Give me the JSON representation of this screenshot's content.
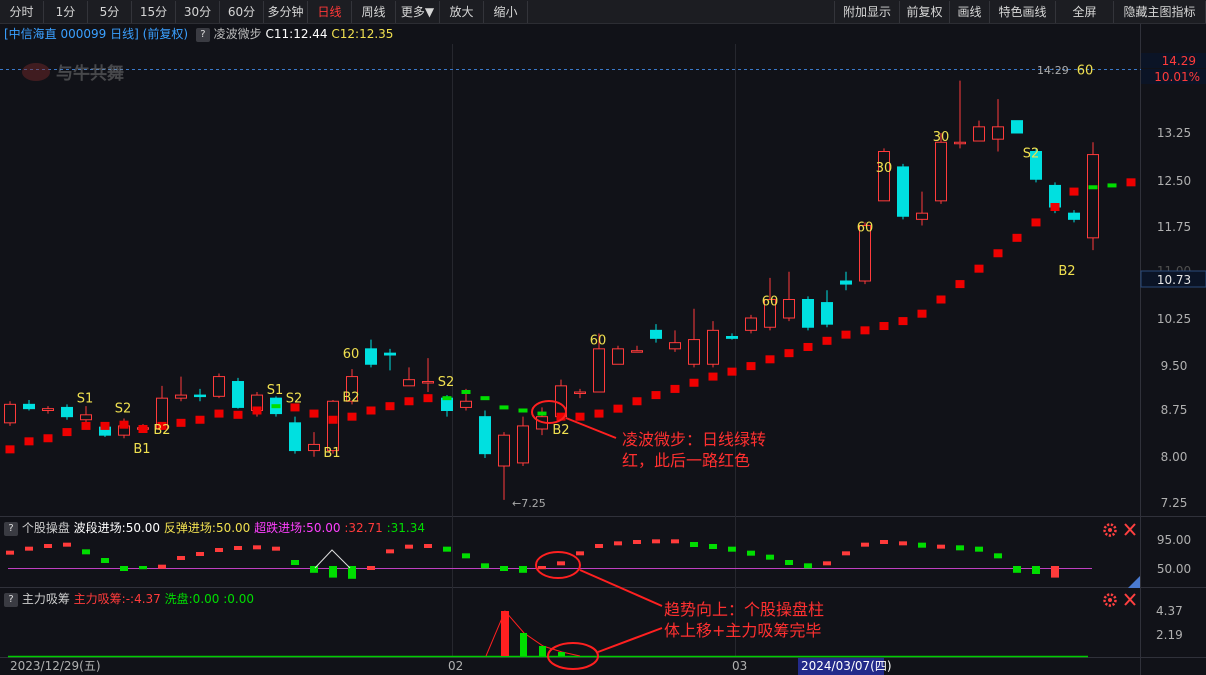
{
  "toolbar": {
    "left": [
      "分时",
      "1分",
      "5分",
      "15分",
      "30分",
      "60分",
      "多分钟",
      "日线",
      "周线",
      "更多▼",
      "放大",
      "缩小"
    ],
    "active": "日线",
    "right": [
      "附加显示",
      "前复权",
      "画线",
      "特色画线",
      "全屏",
      "隐藏主图指标"
    ]
  },
  "main_info": {
    "stock": "[中信海直 000099 日线]",
    "adjust": "(前复权)",
    "q": "?",
    "indicator": "凌波微步",
    "c1": "C11:12.44",
    "c2": "C12:12.35"
  },
  "watermark": "与牛共舞",
  "price_axis": {
    "ticks": [
      "13.25",
      "12.50",
      "11.75",
      "10.25",
      "9.50",
      "8.75",
      "8.00",
      "7.25"
    ],
    "top_price": "14.29",
    "top_pct": "10.01%",
    "cur_price": "10.73",
    "high_label": "14:29",
    "low_label": "7.25",
    "hidden_tick": "11.00"
  },
  "signals": [
    {
      "t": "S1",
      "c": 85,
      "p": 8.88
    },
    {
      "t": "S2",
      "c": 123,
      "p": 8.72
    },
    {
      "t": "B1",
      "c": 142,
      "p": 8.06
    },
    {
      "t": "B2",
      "c": 162,
      "p": 8.37
    },
    {
      "t": "S1",
      "c": 275,
      "p": 9.02
    },
    {
      "t": "S2",
      "c": 294,
      "p": 8.88
    },
    {
      "t": "B1",
      "c": 332,
      "p": 8.0
    },
    {
      "t": "60",
      "c": 351,
      "p": 9.6
    },
    {
      "t": "B2",
      "c": 351,
      "p": 8.9
    },
    {
      "t": "S2",
      "c": 446,
      "p": 9.15
    },
    {
      "t": "B2",
      "c": 561,
      "p": 8.37
    },
    {
      "t": "60",
      "c": 598,
      "p": 9.82
    },
    {
      "t": "60",
      "c": 770,
      "p": 10.45
    },
    {
      "t": "60",
      "c": 865,
      "p": 11.65
    },
    {
      "t": "30",
      "c": 884,
      "p": 12.62
    },
    {
      "t": "30",
      "c": 941,
      "p": 13.12
    },
    {
      "t": "S2",
      "c": 1031,
      "p": 12.85
    },
    {
      "t": "B2",
      "c": 1067,
      "p": 10.95
    },
    {
      "t": "60",
      "c": 1085,
      "p": 14.2
    }
  ],
  "annotation1": {
    "line1": "凌波微步：日线绿转",
    "line2": "红，此后一路红色"
  },
  "annotation2": {
    "line1": "趋势向上：个股操盘柱",
    "line2": "体上移+主力吸筹完毕"
  },
  "panel2": {
    "q": "?",
    "name": "个股操盘",
    "v1": "波段进场:50.00",
    "v2": "反弹进场:50.00",
    "v3": "超跌进场:50.00",
    "v4": ":32.71",
    "v5": ":31.34",
    "ticks": [
      "95.00",
      "50.00"
    ]
  },
  "panel3": {
    "q": "?",
    "name": "主力吸筹",
    "v1": "主力吸筹:-",
    "v1b": ":4.37",
    "v2": "洗盘:0.00",
    "v3": ":0.00",
    "ticks": [
      "4.37",
      "2.19"
    ]
  },
  "date_axis": {
    "d1": "2023/12/29(五)",
    "d2": "02",
    "d3": "03",
    "d4": "2024/03/07(四)"
  },
  "colors": {
    "up": "#ff3b3b",
    "down": "#00e0e0",
    "ma_red": "#ee0000",
    "ma_green": "#00dd00",
    "signal": "#f0e050",
    "annot": "#ff3030"
  },
  "candles": [
    [
      8.55,
      8.85,
      8.9,
      8.5
    ],
    [
      8.85,
      8.78,
      8.92,
      8.75
    ],
    [
      8.75,
      8.78,
      8.82,
      8.7
    ],
    [
      8.8,
      8.65,
      8.85,
      8.6
    ],
    [
      8.6,
      8.68,
      8.82,
      8.5
    ],
    [
      8.48,
      8.35,
      8.55,
      8.32
    ],
    [
      8.35,
      8.5,
      8.62,
      8.3
    ],
    [
      8.45,
      8.47,
      8.53,
      8.42
    ],
    [
      8.45,
      8.95,
      9.15,
      8.45
    ],
    [
      8.95,
      9.0,
      9.3,
      8.9
    ],
    [
      9.0,
      8.98,
      9.1,
      8.9
    ],
    [
      8.98,
      9.3,
      9.35,
      8.95
    ],
    [
      9.22,
      8.8,
      9.28,
      8.78
    ],
    [
      8.75,
      9.0,
      9.05,
      8.65
    ],
    [
      8.95,
      8.7,
      8.98,
      8.65
    ],
    [
      8.55,
      8.1,
      8.65,
      8.05
    ],
    [
      8.1,
      8.2,
      8.4,
      8.0
    ],
    [
      8.1,
      8.9,
      8.92,
      8.05
    ],
    [
      8.9,
      9.3,
      9.42,
      8.85
    ],
    [
      9.75,
      9.5,
      9.9,
      9.45
    ],
    [
      9.68,
      9.65,
      9.75,
      9.4
    ],
    [
      9.15,
      9.25,
      9.45,
      9.15
    ],
    [
      9.2,
      9.22,
      9.6,
      9.05
    ],
    [
      8.95,
      8.75,
      9.0,
      8.65
    ],
    [
      8.8,
      8.9,
      9.1,
      8.75
    ],
    [
      8.65,
      8.05,
      8.75,
      7.98
    ],
    [
      7.85,
      8.35,
      8.4,
      7.3
    ],
    [
      7.9,
      8.5,
      8.65,
      7.85
    ],
    [
      8.45,
      8.65,
      8.8,
      8.35
    ],
    [
      8.65,
      9.15,
      9.25,
      8.6
    ],
    [
      9.05,
      9.05,
      9.1,
      8.95
    ],
    [
      9.05,
      9.75,
      10.0,
      9.05
    ],
    [
      9.5,
      9.75,
      9.8,
      9.5
    ],
    [
      9.7,
      9.72,
      9.8,
      9.7
    ],
    [
      10.05,
      9.92,
      10.15,
      9.85
    ],
    [
      9.75,
      9.85,
      10.05,
      9.7
    ],
    [
      9.5,
      9.9,
      10.4,
      9.45
    ],
    [
      9.5,
      10.05,
      10.2,
      9.45
    ],
    [
      9.95,
      9.92,
      10.0,
      9.9
    ],
    [
      10.05,
      10.25,
      10.3,
      10.0
    ],
    [
      10.1,
      10.55,
      10.9,
      10.05
    ],
    [
      10.25,
      10.55,
      11.0,
      10.2
    ],
    [
      10.55,
      10.1,
      10.6,
      10.05
    ],
    [
      10.5,
      10.15,
      10.7,
      10.1
    ],
    [
      10.85,
      10.8,
      11.0,
      10.7
    ],
    [
      10.85,
      11.75,
      11.8,
      10.8
    ],
    [
      12.15,
      12.95,
      13.0,
      12.15
    ],
    [
      12.7,
      11.9,
      12.75,
      11.85
    ],
    [
      11.85,
      11.95,
      12.3,
      11.75
    ],
    [
      12.15,
      13.1,
      13.25,
      12.1
    ],
    [
      13.08,
      13.1,
      14.1,
      13.0
    ],
    [
      13.12,
      13.35,
      13.45,
      13.12
    ],
    [
      13.15,
      13.35,
      13.8,
      12.95
    ],
    [
      13.45,
      13.25,
      13.45,
      13.25
    ],
    [
      12.95,
      12.5,
      13.0,
      12.45
    ],
    [
      12.4,
      12.05,
      12.45,
      11.95
    ],
    [
      11.95,
      11.85,
      12.0,
      11.8
    ],
    [
      11.55,
      12.9,
      13.1,
      11.35
    ]
  ],
  "ma": [
    [
      8.12,
      0
    ],
    [
      8.25,
      0
    ],
    [
      8.3,
      0
    ],
    [
      8.4,
      0
    ],
    [
      8.5,
      0
    ],
    [
      8.5,
      0
    ],
    [
      8.52,
      0
    ],
    [
      8.45,
      0
    ],
    [
      8.5,
      0
    ],
    [
      8.55,
      0
    ],
    [
      8.6,
      0
    ],
    [
      8.7,
      0
    ],
    [
      8.68,
      0
    ],
    [
      8.75,
      0
    ],
    [
      8.82,
      1
    ],
    [
      8.8,
      0
    ],
    [
      8.7,
      0
    ],
    [
      8.6,
      0
    ],
    [
      8.65,
      0
    ],
    [
      8.75,
      0
    ],
    [
      8.82,
      0
    ],
    [
      8.9,
      0
    ],
    [
      8.95,
      0
    ],
    [
      8.95,
      1
    ],
    [
      9.05,
      1
    ],
    [
      8.95,
      1
    ],
    [
      8.8,
      1
    ],
    [
      8.75,
      1
    ],
    [
      8.7,
      1
    ],
    [
      8.65,
      0
    ],
    [
      8.65,
      0
    ],
    [
      8.7,
      0
    ],
    [
      8.78,
      0
    ],
    [
      8.9,
      0
    ],
    [
      9.0,
      0
    ],
    [
      9.1,
      0
    ],
    [
      9.2,
      0
    ],
    [
      9.3,
      0
    ],
    [
      9.38,
      0
    ],
    [
      9.47,
      0
    ],
    [
      9.58,
      0
    ],
    [
      9.68,
      0
    ],
    [
      9.78,
      0
    ],
    [
      9.88,
      0
    ],
    [
      9.98,
      0
    ],
    [
      10.05,
      0
    ],
    [
      10.12,
      0
    ],
    [
      10.2,
      0
    ],
    [
      10.32,
      0
    ],
    [
      10.55,
      0
    ],
    [
      10.8,
      0
    ],
    [
      11.05,
      0
    ],
    [
      11.3,
      0
    ],
    [
      11.55,
      0
    ],
    [
      11.8,
      0
    ],
    [
      12.05,
      0
    ],
    [
      12.3,
      0
    ],
    [
      12.37,
      1
    ]
  ],
  "extra_ma": [
    [
      12.4,
      1
    ],
    [
      12.45,
      0
    ]
  ],
  "osc": [
    [
      76,
      0
    ],
    [
      82,
      0
    ],
    [
      86,
      0
    ],
    [
      88,
      0
    ],
    [
      78,
      1
    ],
    [
      65,
      1
    ],
    [
      50,
      1
    ],
    [
      48,
      1
    ],
    [
      55,
      0
    ],
    [
      68,
      0
    ],
    [
      74,
      0
    ],
    [
      80,
      0
    ],
    [
      83,
      0
    ],
    [
      84,
      0
    ],
    [
      82,
      0
    ],
    [
      62,
      1
    ],
    [
      42,
      1
    ],
    [
      34,
      1
    ],
    [
      32,
      1
    ],
    [
      52,
      0
    ],
    [
      78,
      0
    ],
    [
      85,
      0
    ],
    [
      86,
      0
    ],
    [
      82,
      1
    ],
    [
      72,
      1
    ],
    [
      57,
      1
    ],
    [
      45,
      1
    ],
    [
      42,
      1
    ],
    [
      48,
      0
    ],
    [
      60,
      0
    ],
    [
      75,
      0
    ],
    [
      86,
      0
    ],
    [
      90,
      0
    ],
    [
      92,
      0
    ],
    [
      93,
      0
    ],
    [
      93,
      0
    ],
    [
      89,
      1
    ],
    [
      86,
      1
    ],
    [
      82,
      1
    ],
    [
      76,
      1
    ],
    [
      70,
      1
    ],
    [
      62,
      1
    ],
    [
      57,
      1
    ],
    [
      60,
      0
    ],
    [
      75,
      0
    ],
    [
      88,
      0
    ],
    [
      92,
      0
    ],
    [
      90,
      0
    ],
    [
      88,
      1
    ],
    [
      85,
      0
    ],
    [
      84,
      1
    ],
    [
      82,
      1
    ],
    [
      72,
      1
    ],
    [
      42,
      1
    ],
    [
      40,
      1
    ],
    [
      34,
      0
    ]
  ]
}
